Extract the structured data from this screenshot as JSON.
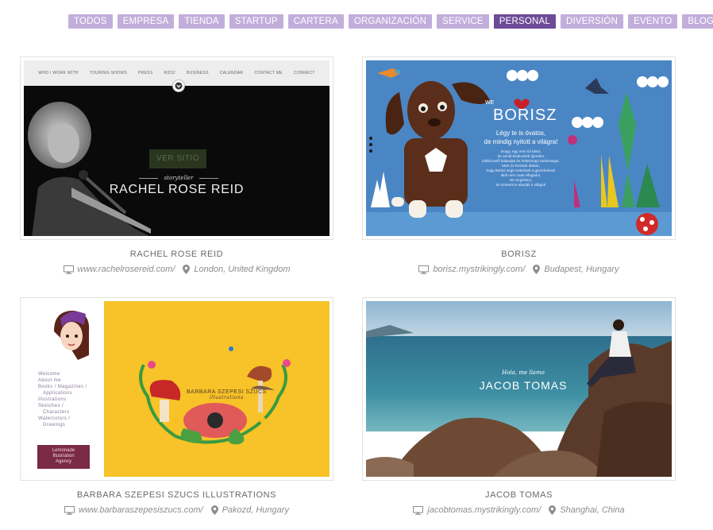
{
  "filters": [
    {
      "label": "TODOS",
      "active": false
    },
    {
      "label": "EMPRESA",
      "active": false
    },
    {
      "label": "TIENDA",
      "active": false
    },
    {
      "label": "STARTUP",
      "active": false
    },
    {
      "label": "CARTERA",
      "active": false
    },
    {
      "label": "ORGANIZACIÓN",
      "active": false
    },
    {
      "label": "SERVICE",
      "active": false
    },
    {
      "label": "PERSONAL",
      "active": true
    },
    {
      "label": "DIVERSIÓN",
      "active": false
    },
    {
      "label": "EVENTO",
      "active": false
    },
    {
      "label": "BLOG",
      "active": false
    }
  ],
  "colors": {
    "tag": "#c2aedb",
    "tag_active": "#6e4b98",
    "meta_text": "#8d8d8d",
    "title_text": "#6a6a6a"
  },
  "cards": [
    {
      "title": "RACHEL ROSE REID",
      "url": "www.rachelrosereid.com/",
      "location": "London, United Kingdom",
      "preview": {
        "nav": [
          "WHO I WORK WITH",
          "TOURING SHOWS",
          "PRESS",
          "KIDS!",
          "BUSINESS",
          "CALENDAR",
          "CONTACT ME",
          "CONNECT"
        ],
        "button": "VER SITIO",
        "tagline": "storyteller",
        "name": "RACHEL ROSE REID"
      }
    },
    {
      "title": "BORISZ",
      "url": "borisz.mystrikingly.com/",
      "location": "Budapest, Hungary",
      "preview": {
        "we": "WE",
        "name": "BORISZ",
        "line1": "Légy te is óvatos,",
        "line2": "de mindig nyitott a világra!",
        "small1": "óvagy, egy nem túl bátor,",
        "small2": "de annál kíváncsibb újember",
        "small3": "lebilincselő kalandjai és hétköznapi nehézségei.",
        "small4": "Mert mi hiszünk abban,",
        "small5": "hogy Borisz segít szüleinek a gyerekeknek",
        "small6": "akik nem csak elfogadni,",
        "small7": "de megérteni,",
        "small8": "és szeretni is akarják a világot!"
      }
    },
    {
      "title": "BARBARA SZEPESI SZUCS ILLUSTRATIONS",
      "url": "www.barbaraszepesiszucs.com/",
      "location": "Pakozd, Hungary",
      "preview": {
        "menu": [
          "Welcome",
          "About me",
          "Books / Magazines /",
          "Applications",
          "Illustrations",
          "Sketches /",
          "Characters",
          "Watercolors /",
          "Drawings"
        ],
        "agency1": "Lemonade",
        "agency2": "Illustration",
        "agency3": "Agency",
        "art_title": "BARBARA SZEPESI SZUCS",
        "art_sub": "illustrations"
      }
    },
    {
      "title": "JACOB TOMAS",
      "url": "jacobtomas.mystrikingly.com/",
      "location": "Shanghai, China",
      "preview": {
        "hola": "Hola, me llamo",
        "name": "JACOB TOMAS"
      }
    }
  ]
}
